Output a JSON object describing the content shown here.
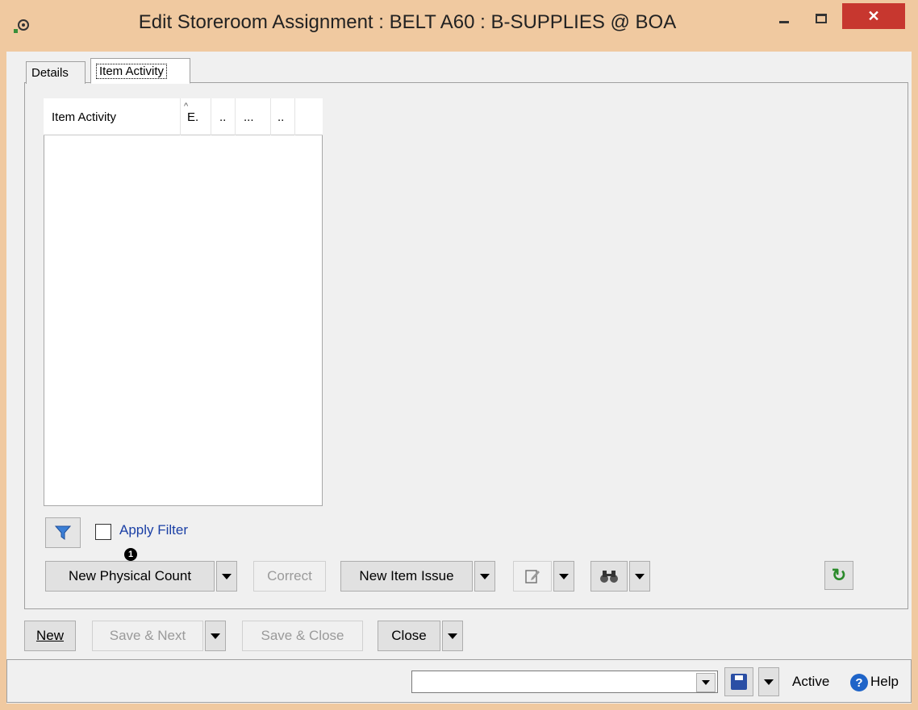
{
  "window": {
    "title": "Edit Storeroom Assignment : BELT A60 : B-SUPPLIES @ BOA",
    "close_glyph": "✕"
  },
  "tabs": [
    {
      "label": "Details"
    },
    {
      "label": "Item Activity"
    }
  ],
  "grid": {
    "columns": [
      "Item Activity",
      "E.",
      "..",
      "...",
      ".."
    ],
    "sort_indicator": "^"
  },
  "filter": {
    "apply_label": "Apply Filter",
    "checked": false
  },
  "toolbar": {
    "new_physical_count": "New Physical Count",
    "badge": "1",
    "correct": "Correct",
    "new_item_issue": "New Item Issue",
    "refresh_glyph": "↻"
  },
  "footer": {
    "new": "New",
    "save_next": "Save & Next",
    "save_close": "Save & Close",
    "close": "Close"
  },
  "status": {
    "state": "Active",
    "help": "Help",
    "help_glyph": "?"
  },
  "colors": {
    "titlebar": "#f0c9a0",
    "close_button": "#c7372f",
    "link_blue": "#1a3fa5"
  }
}
